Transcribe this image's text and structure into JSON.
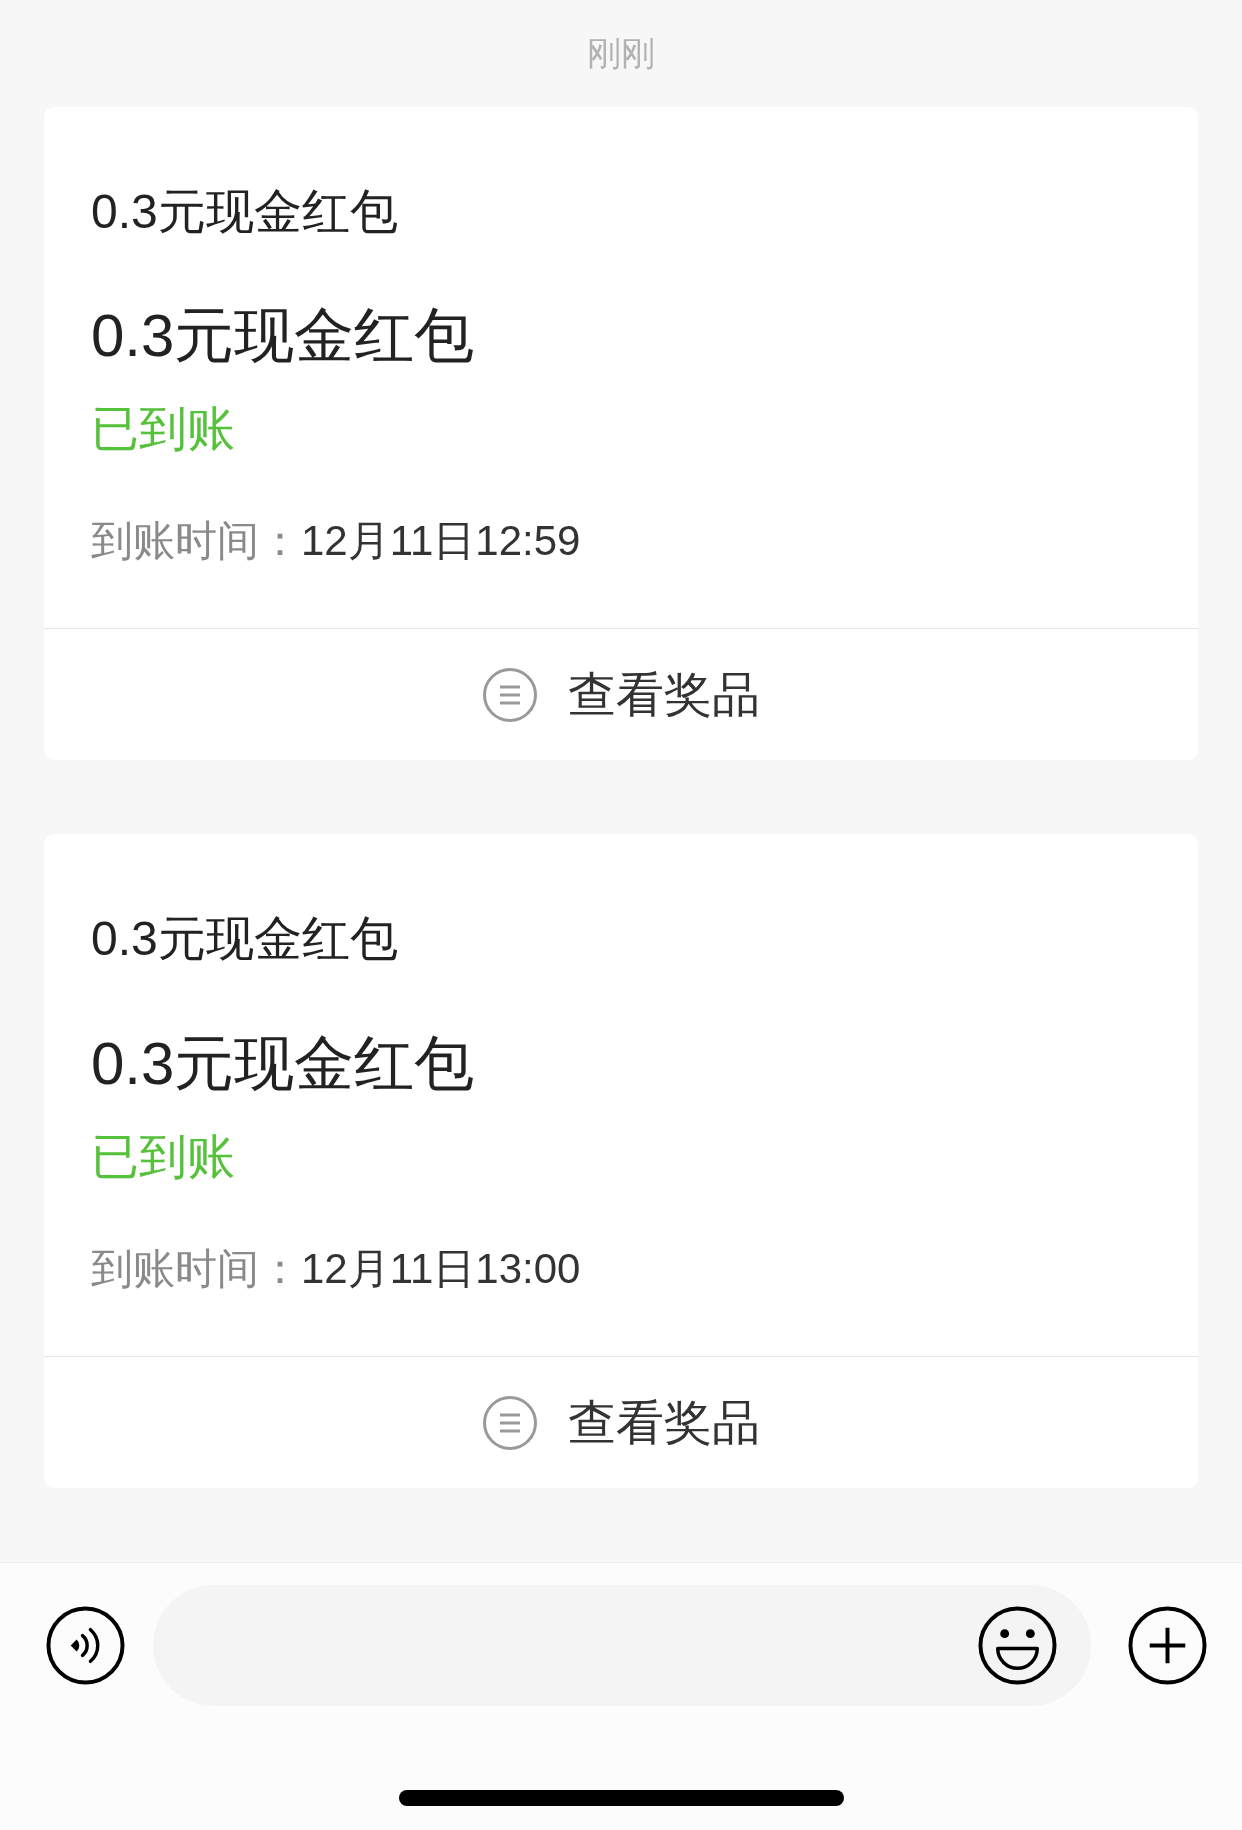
{
  "timestamp": "刚刚",
  "cards": [
    {
      "title": "0.3元现金红包",
      "prize": "0.3元现金红包",
      "status": "已到账",
      "arrival_label": "到账时间：",
      "arrival_time": "12月11日12:59",
      "action": "查看奖品"
    },
    {
      "title": "0.3元现金红包",
      "prize": "0.3元现金红包",
      "status": "已到账",
      "arrival_label": "到账时间：",
      "arrival_time": "12月11日13:00",
      "action": "查看奖品"
    }
  ]
}
